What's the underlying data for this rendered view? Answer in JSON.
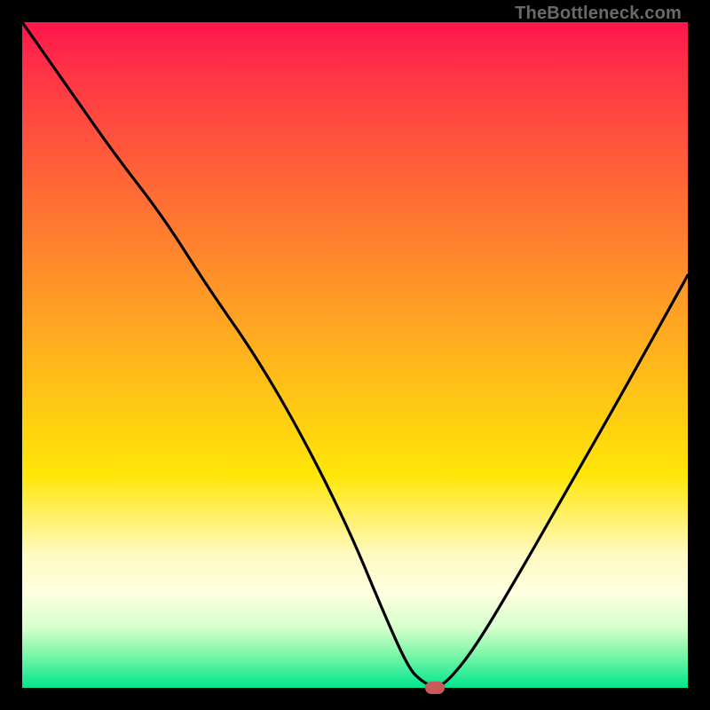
{
  "watermark": "TheBottleneck.com",
  "colors": {
    "frame_bg": "#000000",
    "marker": "#c85a5a",
    "curve": "#000000"
  },
  "chart_data": {
    "type": "line",
    "title": "",
    "xlabel": "",
    "ylabel": "",
    "xlim": [
      0,
      100
    ],
    "ylim": [
      0,
      100
    ],
    "grid": false,
    "legend": false,
    "series": [
      {
        "name": "bottleneck-curve",
        "x": [
          0,
          7,
          14,
          21,
          28,
          35,
          42,
          49,
          54,
          58,
          60,
          62,
          64,
          68,
          74,
          82,
          90,
          100
        ],
        "values": [
          100,
          90,
          80,
          71,
          60,
          50,
          38,
          24,
          12,
          3,
          1,
          0,
          1,
          6,
          16,
          30,
          44,
          62
        ]
      }
    ],
    "marker": {
      "x": 62,
      "y": 0
    },
    "annotations": []
  }
}
